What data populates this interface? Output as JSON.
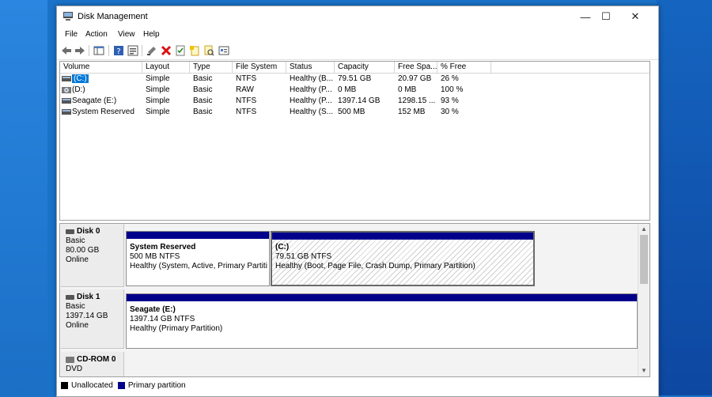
{
  "window": {
    "title": "Disk Management",
    "minimize": "—",
    "maximize": "☐",
    "close": "✕"
  },
  "menu": [
    "File",
    "Action",
    "View",
    "Help"
  ],
  "volume_table": {
    "columns": [
      "Volume",
      "Layout",
      "Type",
      "File System",
      "Status",
      "Capacity",
      "Free Spa...",
      "% Free"
    ],
    "rows": [
      {
        "volume": "(C:)",
        "layout": "Simple",
        "type": "Basic",
        "fs": "NTFS",
        "status": "Healthy (B...",
        "capacity": "79.51 GB",
        "free": "20.97 GB",
        "pct": "26 %"
      },
      {
        "volume": "(D:)",
        "layout": "Simple",
        "type": "Basic",
        "fs": "RAW",
        "status": "Healthy (P...",
        "capacity": "0 MB",
        "free": "0 MB",
        "pct": "100 %"
      },
      {
        "volume": "Seagate (E:)",
        "layout": "Simple",
        "type": "Basic",
        "fs": "NTFS",
        "status": "Healthy (P...",
        "capacity": "1397.14 GB",
        "free": "1298.15 ...",
        "pct": "93 %"
      },
      {
        "volume": "System Reserved",
        "layout": "Simple",
        "type": "Basic",
        "fs": "NTFS",
        "status": "Healthy (S...",
        "capacity": "500 MB",
        "free": "152 MB",
        "pct": "30 %"
      }
    ]
  },
  "disks": [
    {
      "name": "Disk 0",
      "type": "Basic",
      "size": "80.00 GB",
      "status": "Online",
      "partitions": [
        {
          "name": "System Reserved",
          "size": "500 MB NTFS",
          "status": "Healthy (System, Active, Primary Partitio"
        },
        {
          "name": "(C:)",
          "size": "79.51 GB NTFS",
          "status": "Healthy (Boot, Page File, Crash Dump, Primary Partition)"
        }
      ]
    },
    {
      "name": "Disk 1",
      "type": "Basic",
      "size": "1397.14 GB",
      "status": "Online",
      "partitions": [
        {
          "name": "Seagate  (E:)",
          "size": "1397.14 GB NTFS",
          "status": "Healthy (Primary Partition)"
        }
      ]
    },
    {
      "name": "CD-ROM 0",
      "type": "DVD",
      "size": "",
      "status": "",
      "partitions": []
    }
  ],
  "legend": {
    "unallocated": "Unallocated",
    "primary": "Primary partition",
    "unallocated_color": "#000000",
    "primary_color": "#00008b"
  },
  "colors": {
    "selection": "#0078d7",
    "partition_bar": "#00008b"
  }
}
